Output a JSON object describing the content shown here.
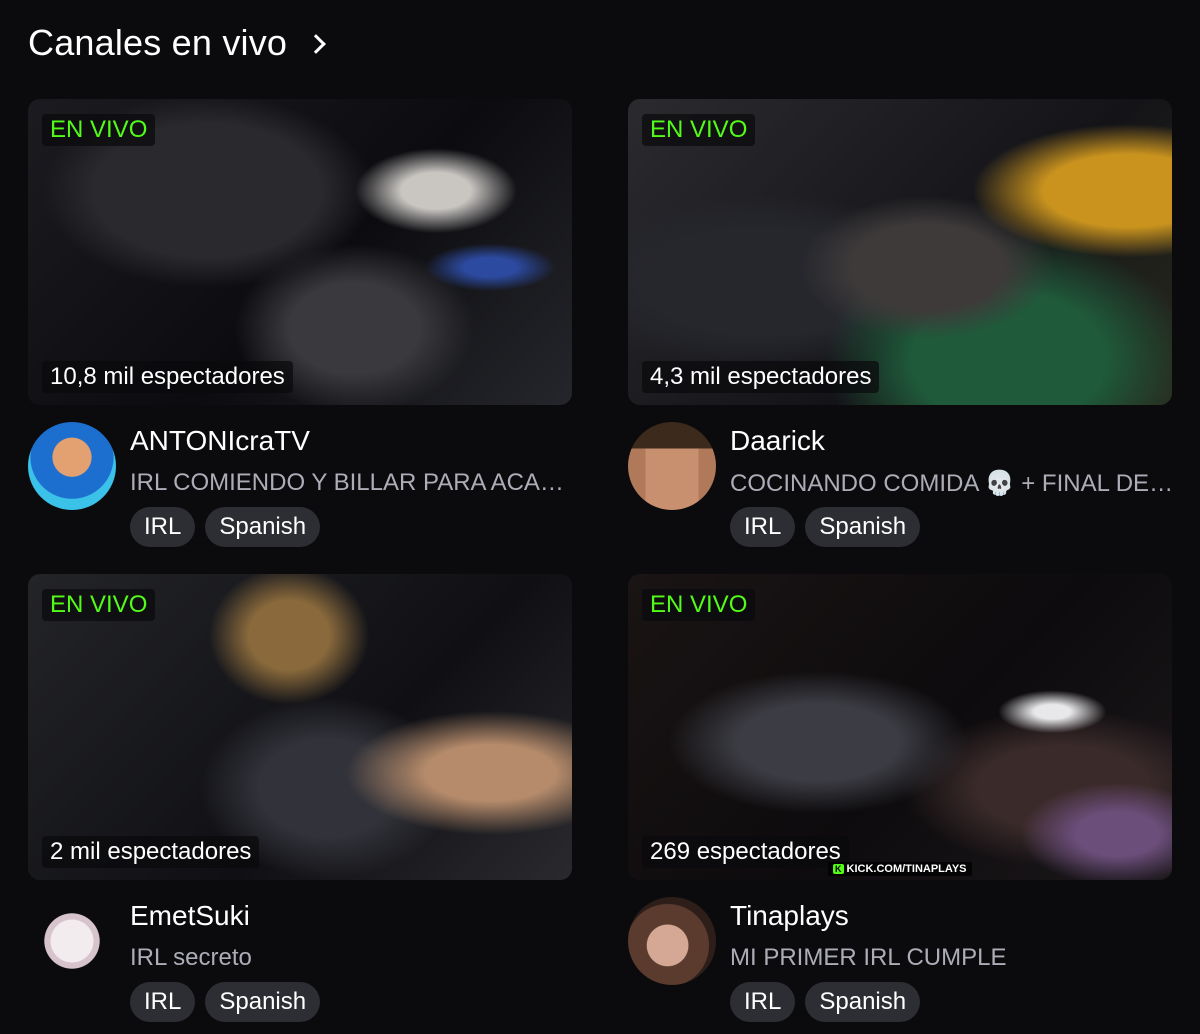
{
  "section": {
    "title": "Canales en vivo",
    "chevron_icon": "chevron-right-icon"
  },
  "colors": {
    "accent_live": "#53fc18",
    "background": "#0b0b0d",
    "tag_bg": "#2d2e33",
    "subtitle": "#adadb8"
  },
  "channels": [
    {
      "live_label": "EN VIVO",
      "viewers": "10,8 mil espectadores",
      "name": "ANTONIcraTV",
      "title": "IRL COMIENDO Y BILLAR PARA ACABAR EL DIA",
      "tags": [
        "IRL",
        "Spanish"
      ]
    },
    {
      "live_label": "EN VIVO",
      "viewers": "4,3 mil espectadores",
      "name": "Daarick",
      "title": "COCINANDO COMIDA 💀 + FINAL DEL DIA",
      "tags": [
        "IRL",
        "Spanish"
      ]
    },
    {
      "live_label": "EN VIVO",
      "viewers": "2 mil espectadores",
      "name": "EmetSuki",
      "title": "IRL secreto",
      "tags": [
        "IRL",
        "Spanish"
      ]
    },
    {
      "live_label": "EN VIVO",
      "viewers": "269 espectadores",
      "name": "Tinaplays",
      "title": "MI PRIMER IRL CUMPLE",
      "tags": [
        "IRL",
        "Spanish"
      ],
      "watermark_k": "K",
      "watermark": "KICK.COM/TINAPLAYS"
    }
  ]
}
